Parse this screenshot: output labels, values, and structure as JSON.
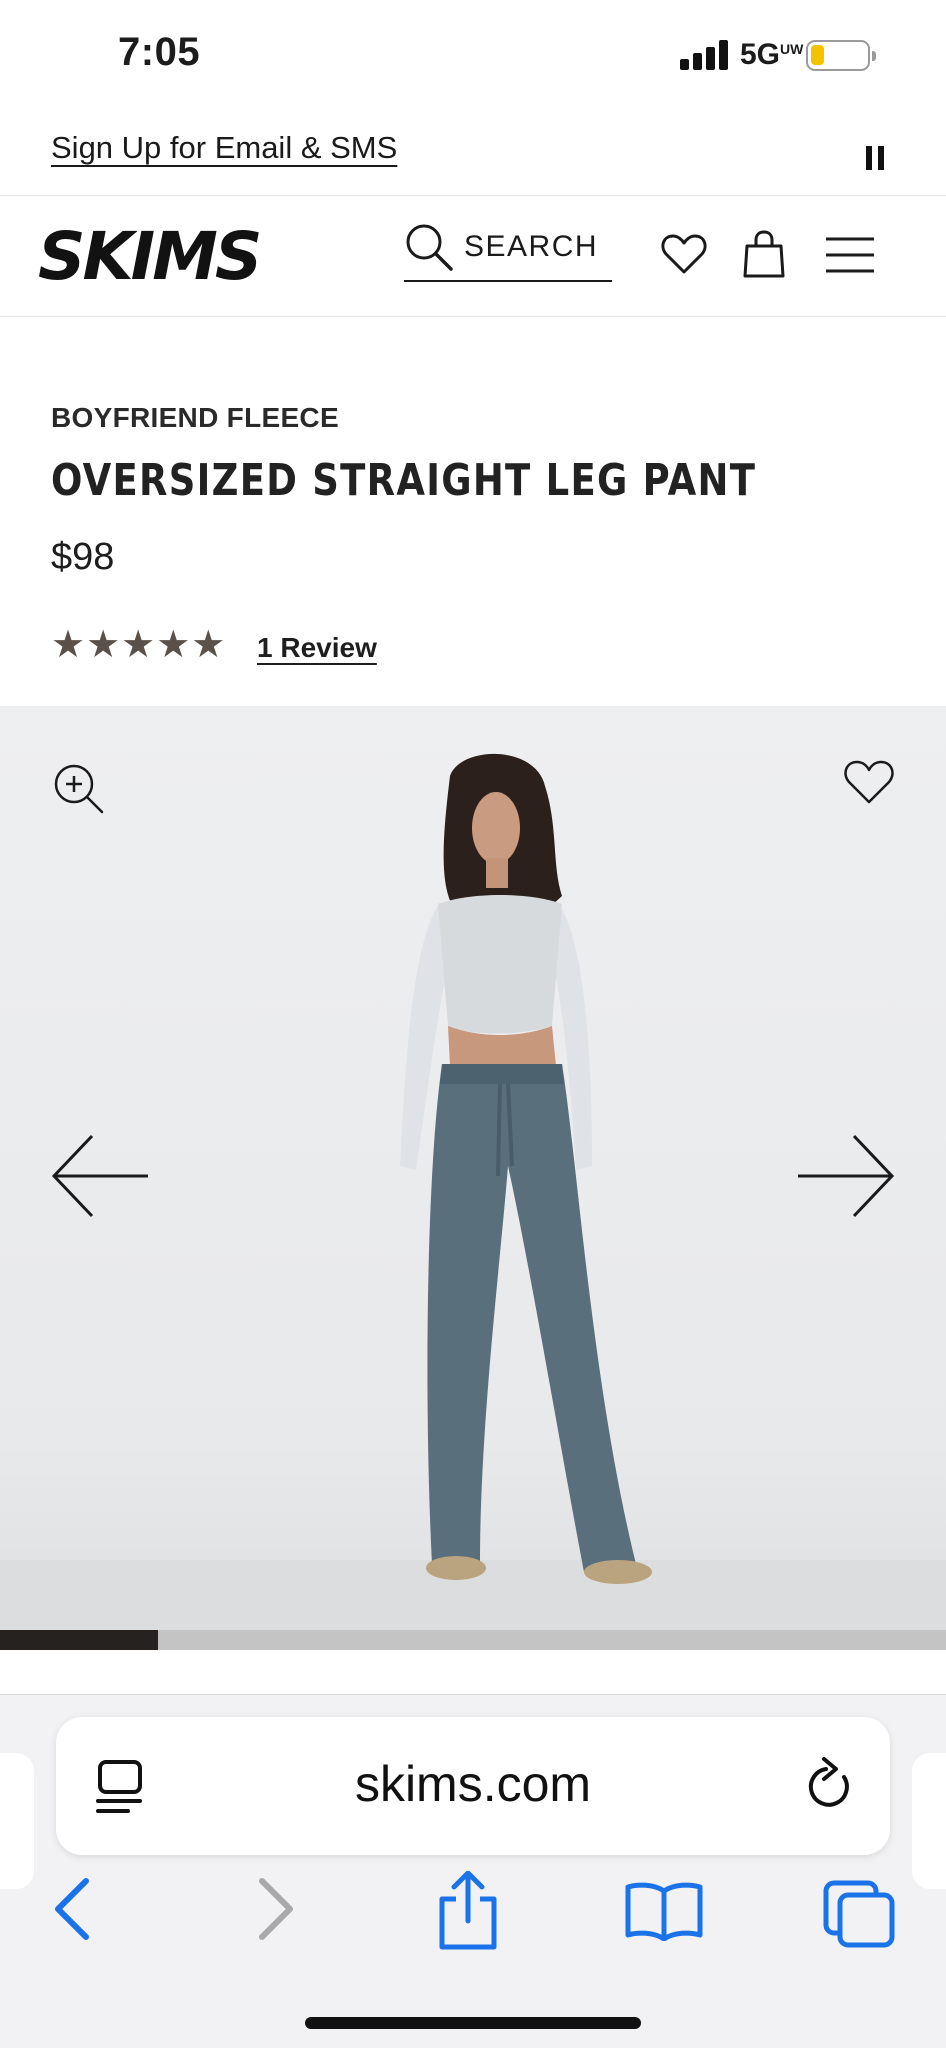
{
  "status_bar": {
    "time": "7:05",
    "network": "5G",
    "network_badge": "UW",
    "battery_level": 0.2,
    "battery_color": "#f5c200"
  },
  "promo": {
    "signup_text": "Sign Up for Email & SMS",
    "pause_icon": "pause-icon"
  },
  "header": {
    "logo": "SKIMS",
    "search_label": "SEARCH",
    "icons": [
      "search-icon",
      "heart-icon",
      "shopping-bag-icon",
      "menu-icon"
    ]
  },
  "product": {
    "collection": "BOYFRIEND FLEECE",
    "title": "OVERSIZED STRAIGHT LEG PANT",
    "price": "$98",
    "stars": "★★★★★",
    "rating": 5,
    "review_link": "1 Review"
  },
  "gallery": {
    "icons": [
      "zoom-in-icon",
      "heart-icon",
      "arrow-left-icon",
      "arrow-right-icon"
    ],
    "progress": 0.167,
    "progress_color": "#252220"
  },
  "browser": {
    "url": "skims.com",
    "accent_color": "#1a73e8",
    "icons": [
      "reader-icon",
      "reload-icon",
      "back-icon",
      "forward-icon",
      "share-icon",
      "bookmarks-icon",
      "tabs-icon"
    ]
  }
}
